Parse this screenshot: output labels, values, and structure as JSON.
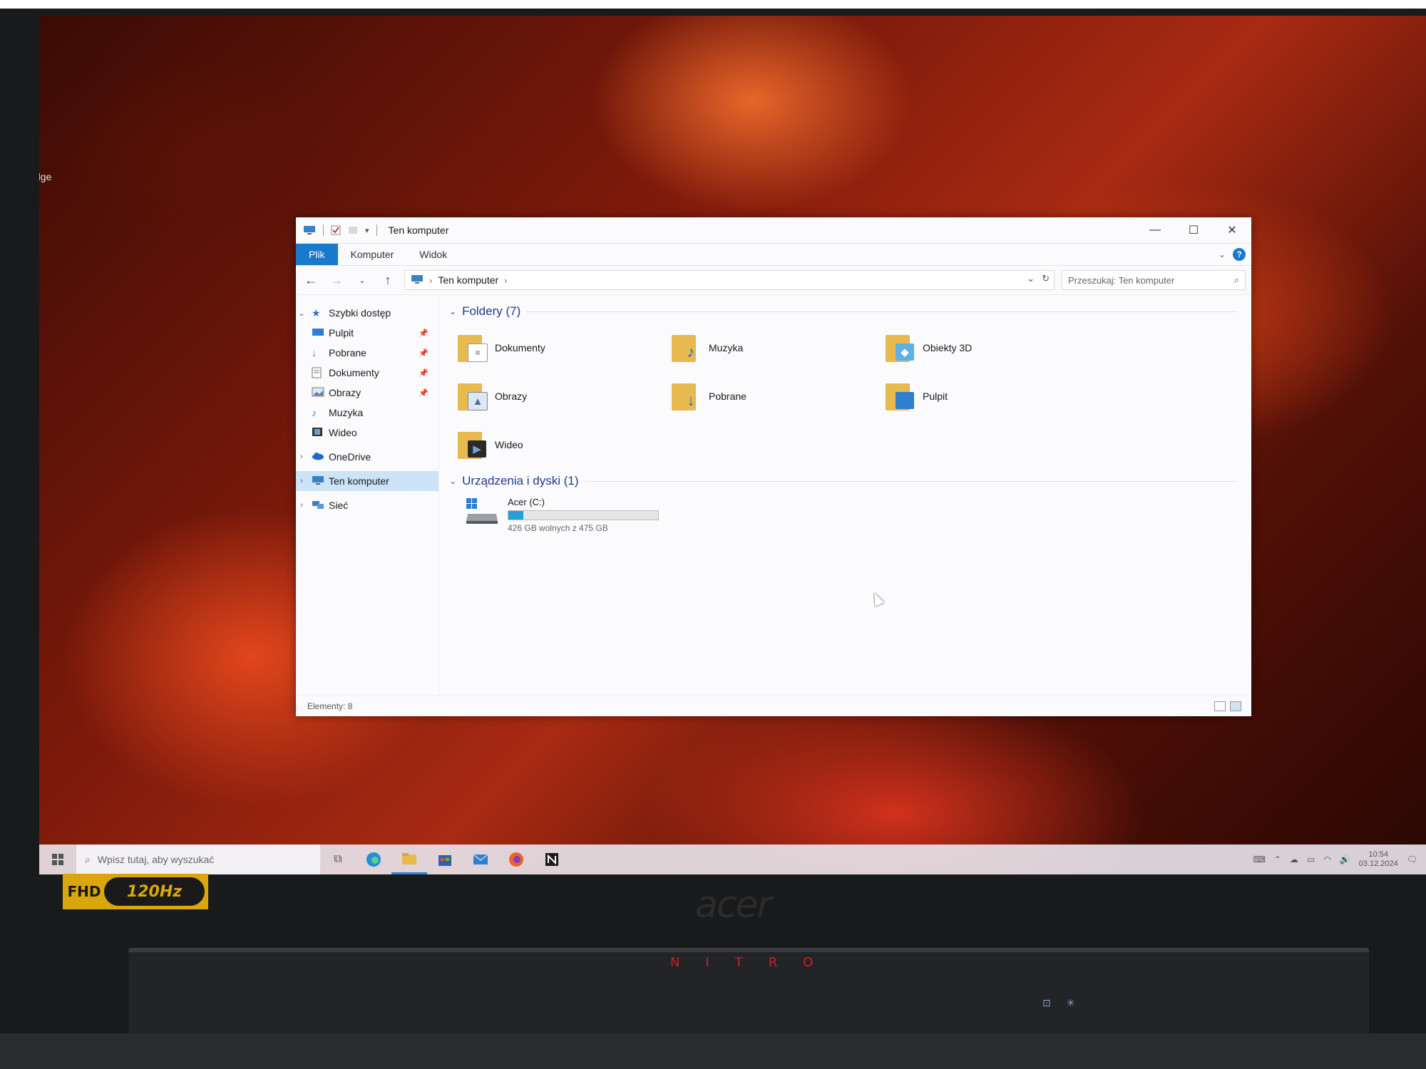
{
  "desktop": {
    "edge_label": "dge"
  },
  "window": {
    "title": "Ten komputer",
    "controls": {
      "minimize": "—",
      "maximize": "☐",
      "close": "✕"
    },
    "ribbon_tabs": [
      "Plik",
      "Komputer",
      "Widok"
    ],
    "help": "?",
    "address": {
      "location": "Ten komputer"
    },
    "search_placeholder": "Przeszukaj: Ten komputer",
    "sidebar": [
      {
        "label": "Szybki dostęp",
        "icon": "star-icon"
      },
      {
        "label": "Pulpit",
        "icon": "desktop-icon"
      },
      {
        "label": "Pobrane",
        "icon": "download-icon"
      },
      {
        "label": "Dokumenty",
        "icon": "document-icon"
      },
      {
        "label": "Obrazy",
        "icon": "picture-icon"
      },
      {
        "label": "Muzyka",
        "icon": "music-icon"
      },
      {
        "label": "Wideo",
        "icon": "video-icon"
      },
      {
        "label": "OneDrive",
        "icon": "cloud-icon"
      },
      {
        "label": "Ten komputer",
        "icon": "computer-icon"
      },
      {
        "label": "Sieć",
        "icon": "network-icon"
      }
    ],
    "folders_header": "Foldery (7)",
    "folders": [
      {
        "label": "Dokumenty",
        "icon": "documents-folder-icon"
      },
      {
        "label": "Muzyka",
        "icon": "music-folder-icon"
      },
      {
        "label": "Obiekty 3D",
        "icon": "3d-objects-folder-icon"
      },
      {
        "label": "Obrazy",
        "icon": "pictures-folder-icon"
      },
      {
        "label": "Pobrane",
        "icon": "downloads-folder-icon"
      },
      {
        "label": "Pulpit",
        "icon": "desktop-folder-icon"
      },
      {
        "label": "Wideo",
        "icon": "videos-folder-icon"
      }
    ],
    "devices_header": "Urządzenia i dyski (1)",
    "drive": {
      "label": "Acer (C:)",
      "free_text": "426 GB wolnych z 475 GB",
      "used_fraction": 0.1
    },
    "status": "Elementy: 8"
  },
  "taskbar": {
    "search_placeholder": "Wpisz tutaj, aby wyszukać",
    "time": "10:54",
    "date": "03.12.2024"
  },
  "hardware": {
    "badge_fhd": "FHD",
    "badge_hz": "120Hz",
    "brand": "acer",
    "model": "NITRO"
  },
  "colors": {
    "accent": "#1979ca",
    "folder": "#e7b94e",
    "drive_bar": "#26a0da"
  }
}
